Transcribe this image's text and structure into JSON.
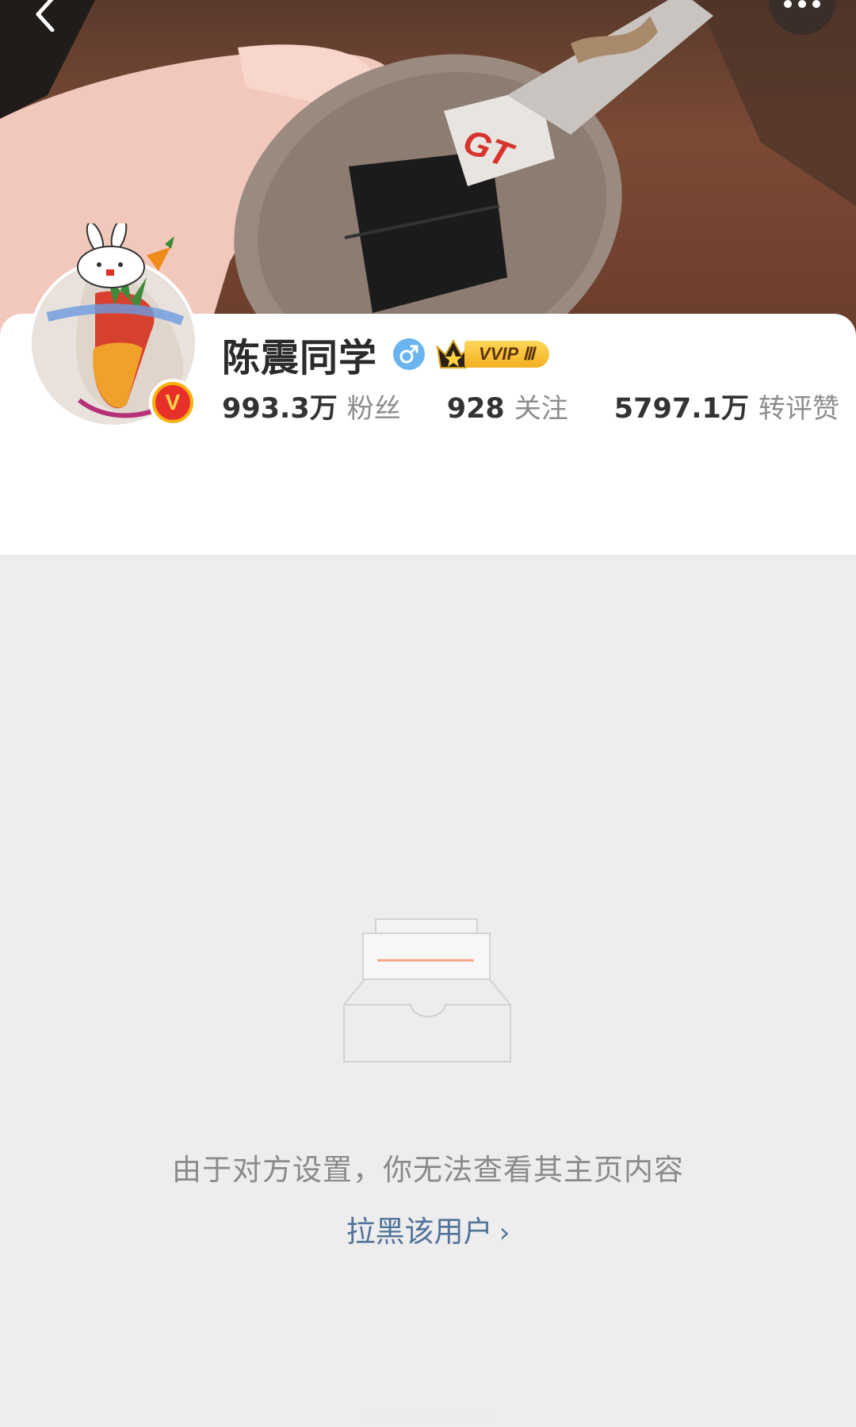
{
  "header": {
    "back_icon": "chevron-left-icon",
    "more_icon": "more-dots-icon"
  },
  "cover": {
    "key_label": "GT"
  },
  "profile": {
    "username": "陈震同学",
    "gender_icon": "male-icon",
    "vip_label": "VVIP Ⅲ",
    "verified_badge": "V",
    "stats": [
      {
        "value": "993.3万",
        "label": "粉丝"
      },
      {
        "value": "928",
        "label": "关注"
      },
      {
        "value": "5797.1万",
        "label": "转评赞"
      }
    ]
  },
  "empty_state": {
    "message": "由于对方设置，你无法查看其主页内容",
    "block_link": "拉黑该用户",
    "block_link_chevron": "›"
  },
  "colors": {
    "link": "#52739a",
    "verified": "#f7b20f",
    "gender": "#6ab5ef"
  }
}
